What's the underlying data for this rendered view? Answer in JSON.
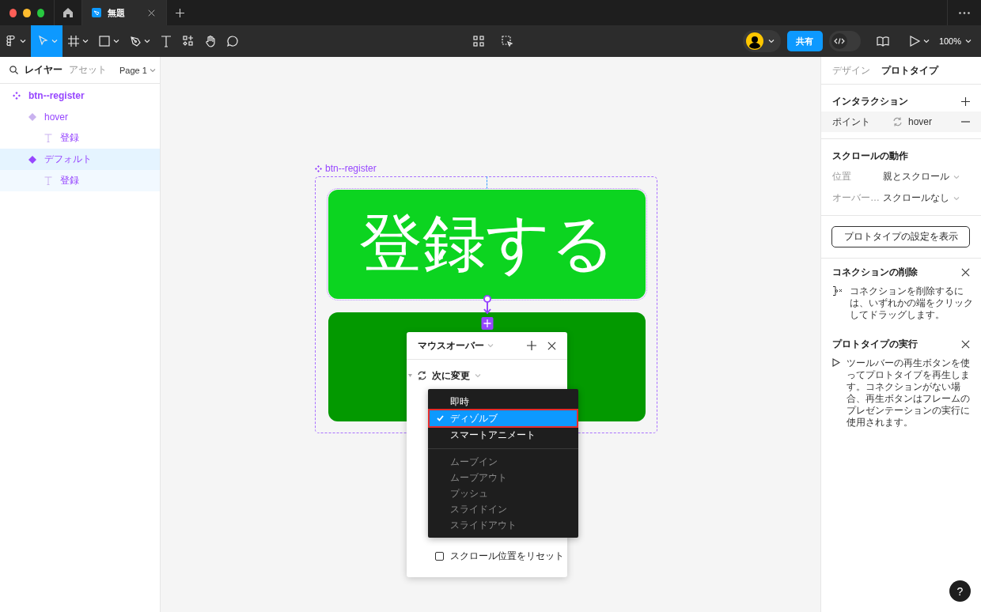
{
  "tabs": [
    {
      "label": "無題",
      "selected": true
    }
  ],
  "toolbar": {
    "share_button": "共有",
    "dev_mode": false,
    "zoom": "100%"
  },
  "layers_panel": {
    "tabs": [
      {
        "label": "レイヤー",
        "selected": true
      },
      {
        "label": "アセット",
        "selected": false
      }
    ],
    "page": "Page 1",
    "layers": [
      {
        "name": "btn--register",
        "kind": "component_set",
        "selected": false,
        "children": [
          {
            "name": "hover",
            "kind": "variant",
            "selected": false,
            "children": [
              {
                "name": "登録",
                "kind": "text",
                "selected": false
              }
            ]
          },
          {
            "name": "デフォルト",
            "kind": "variant",
            "selected": true,
            "children": [
              {
                "name": "登録",
                "kind": "text",
                "selected": false
              }
            ]
          }
        ]
      }
    ]
  },
  "canvas": {
    "frame_label": "btn--register",
    "buttons": [
      {
        "label": "登録する"
      }
    ],
    "interaction_popup": {
      "trigger": "マウスオーバー",
      "action": "次に変更",
      "checkbox": {
        "label": "スクロール位置をリセット",
        "checked": false
      }
    },
    "animation_menu": {
      "groups": [
        [
          {
            "label": "即時",
            "selected": false,
            "disabled": false
          },
          {
            "label": "ディゾルブ",
            "selected": true,
            "disabled": false
          },
          {
            "label": "スマートアニメート",
            "selected": false,
            "disabled": false
          }
        ],
        [
          {
            "label": "ムーブイン",
            "selected": false,
            "disabled": true
          },
          {
            "label": "ムーブアウト",
            "selected": false,
            "disabled": true
          },
          {
            "label": "プッシュ",
            "selected": false,
            "disabled": true
          },
          {
            "label": "スライドイン",
            "selected": false,
            "disabled": true
          },
          {
            "label": "スライドアウト",
            "selected": false,
            "disabled": true
          }
        ]
      ]
    }
  },
  "properties_panel": {
    "tabs": [
      {
        "label": "デザイン",
        "selected": false
      },
      {
        "label": "プロトタイプ",
        "selected": true
      }
    ],
    "interactions": {
      "title": "インタラクション",
      "rows": [
        {
          "trigger": "ポイント",
          "action": "hover"
        }
      ]
    },
    "scroll": {
      "title": "スクロールの動作",
      "fields": [
        {
          "label": "位置",
          "value": "親とスクロール"
        },
        {
          "label": "オーバー…",
          "value": "スクロールなし"
        }
      ]
    },
    "settings_button": "プロトタイプの設定を表示",
    "tips": [
      {
        "title": "コネクションの削除",
        "text": "コネクションを削除するには、いずれかの端をクリックしてドラッグします。"
      },
      {
        "title": "プロトタイプの実行",
        "text": "ツールバーの再生ボタンを使ってプロトタイプを再生します。コネクションがない場合、再生ボタンはフレームのプレゼンテーションの実行に使用されます。"
      }
    ]
  },
  "help_button": "?"
}
